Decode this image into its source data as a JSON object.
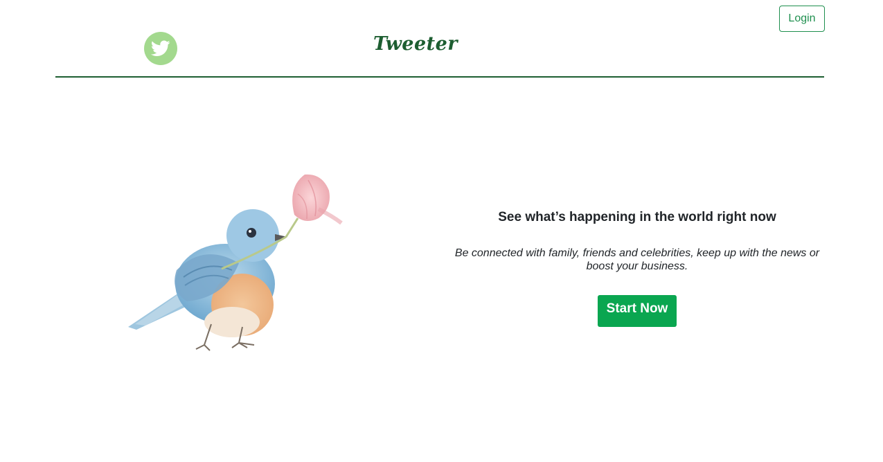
{
  "header": {
    "brand": "Tweeter",
    "login_label": "Login",
    "logo_icon": "twitter-bird-icon"
  },
  "hero": {
    "image": "bluebird-with-flower-illustration",
    "headline": "See what’s happening in the world right now",
    "subtext": "Be connected with family, friends and celebrities, keep up with the news or boost your business.",
    "cta_label": "Start Now"
  },
  "colors": {
    "brand_green": "#1d5e31",
    "button_green": "#0aa650",
    "logo_circle": "#a3d98e",
    "outline_green": "#1e8f4e"
  }
}
